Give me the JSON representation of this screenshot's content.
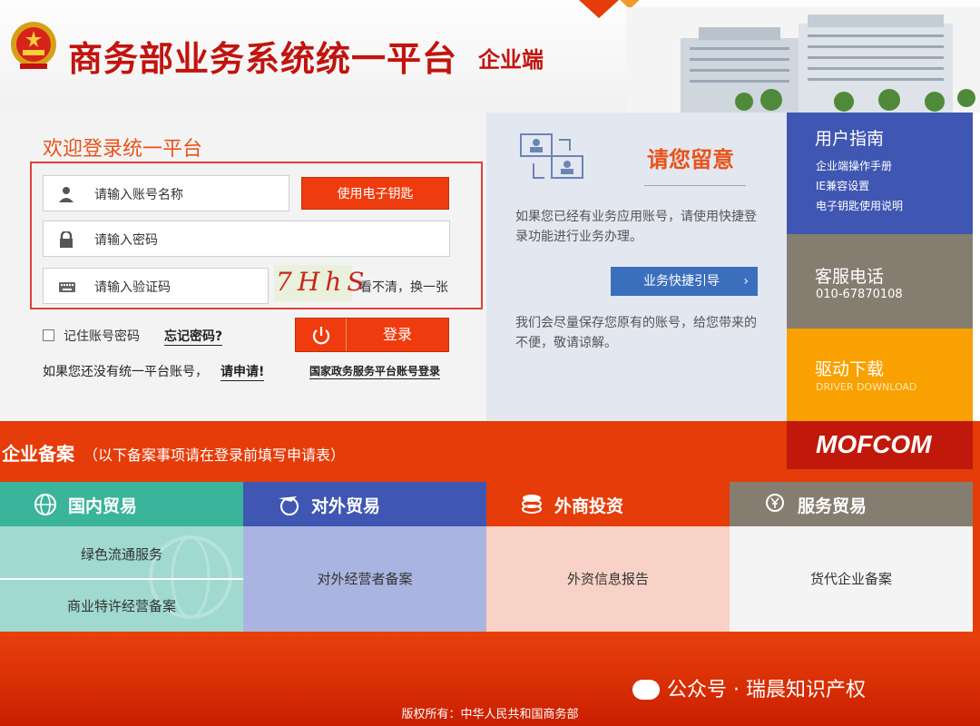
{
  "header": {
    "title": "商务部业务系统统一平台",
    "subtitle": "企业端"
  },
  "login": {
    "welcome": "欢迎登录统一平台",
    "account_placeholder": "请输入账号名称",
    "password_placeholder": "请输入密码",
    "captcha_placeholder": "请输入验证码",
    "ekey_button": "使用电子钥匙",
    "captcha_text": "7HhS",
    "captcha_refresh": "看不清，换一张",
    "remember": "记住账号密码",
    "forgot": "忘记密码?",
    "login_button": "登录",
    "no_account": "如果您还没有统一平台账号，",
    "register": "请申请!",
    "gov_login": "国家政务服务平台账号登录"
  },
  "notice": {
    "title": "请您留意",
    "text1": "如果您已经有业务应用账号，请使用快捷登录功能进行业务办理。",
    "guide_button": "业务快捷引导",
    "text2": "我们会尽量保存您原有的账号，给您带来的不便，敬请谅解。"
  },
  "side": {
    "guide_title": "用户指南",
    "guide_links": [
      "企业端操作手册",
      "IE兼容设置",
      "电子钥匙使用说明"
    ],
    "service_title": "客服电话",
    "service_phone": "010-67870108",
    "driver_title": "驱动下载",
    "driver_sub": "DRIVER DOWNLOAD"
  },
  "filing": {
    "title": "企业备案",
    "note": "（以下备案事项请在登录前填写申请表）",
    "logo": "MOFCOM"
  },
  "categories": [
    {
      "title": "国内贸易",
      "items": [
        "绿色流通服务",
        "商业特许经营备案"
      ],
      "color": "#3ab49a",
      "bg": "#9fd9cf"
    },
    {
      "title": "对外贸易",
      "items": [
        "对外经营者备案"
      ],
      "color": "#3f57b2",
      "bg": "#a9b5e0"
    },
    {
      "title": "外商投资",
      "items": [
        "外资信息报告"
      ],
      "color": "#e53c09",
      "bg": "#f8d2c6"
    },
    {
      "title": "服务贸易",
      "items": [
        "货代企业备案"
      ],
      "color": "#857d70",
      "bg": "#f4f4f4"
    }
  ],
  "footer": {
    "copyright": "版权所有：中华人民共和国商务部",
    "watermark": "公众号 · 瑞晨知识产权"
  }
}
